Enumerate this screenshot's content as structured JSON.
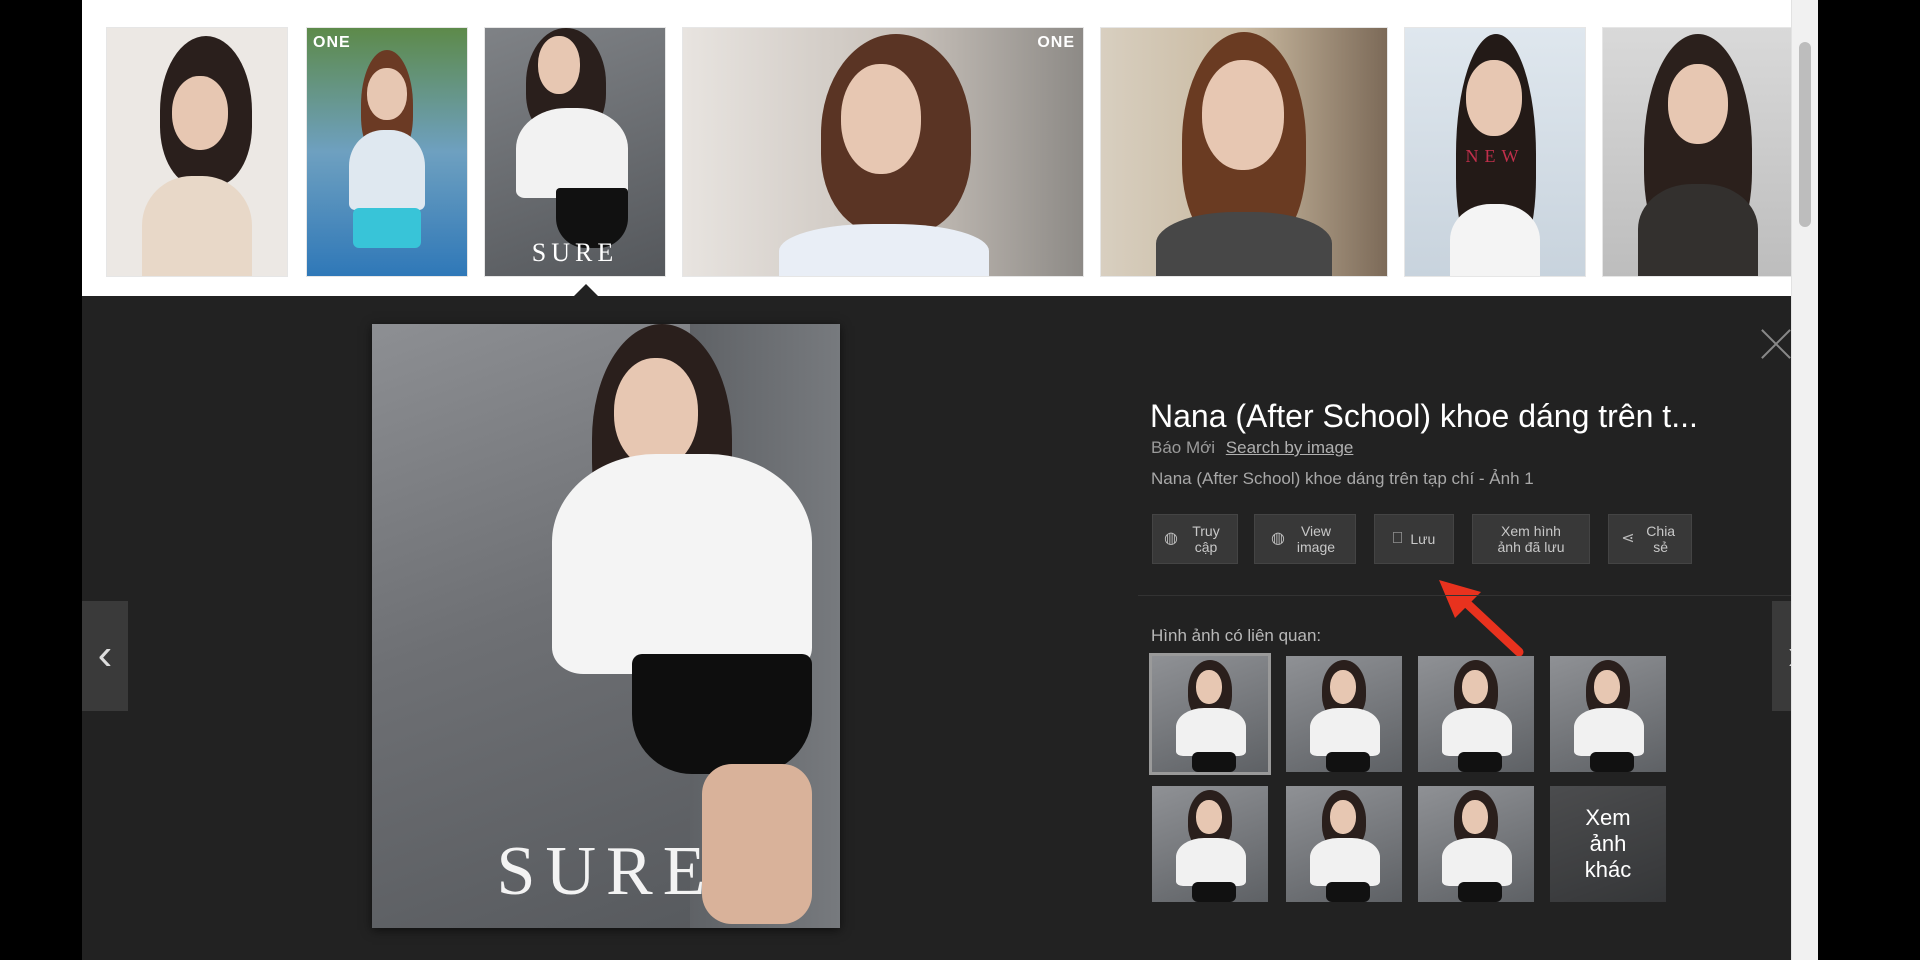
{
  "thumbnails": [
    {
      "tag": ""
    },
    {
      "tag": "ONE"
    },
    {
      "tag": "",
      "magazine": "SURE"
    },
    {
      "tag": "ONE"
    },
    {
      "tag": ""
    },
    {
      "tag": "",
      "magazine": "NEW"
    },
    {
      "tag": ""
    }
  ],
  "detail": {
    "title": "Nana (After School) khoe dáng trên t...",
    "source": "Báo Mới",
    "search_by_image": "Search by image",
    "caption": "Nana (After School) khoe dáng trên tạp chí - Ảnh 1",
    "main_image_text": "SURE",
    "actions": [
      {
        "label": "Truy cập",
        "icon": "globe-icon"
      },
      {
        "label": "View image",
        "icon": "globe-icon"
      },
      {
        "label": "Lưu",
        "icon": "bookmark-icon"
      },
      {
        "label": "Xem hình ảnh đã lưu",
        "icon": ""
      },
      {
        "label": "Chia sẻ",
        "icon": "share-icon"
      }
    ],
    "related_label": "Hình ảnh có liên quan:",
    "more_label": "Xem ảnh khác"
  },
  "colors": {
    "panel": "#222222",
    "pointer_arrow": "#e8321e"
  }
}
